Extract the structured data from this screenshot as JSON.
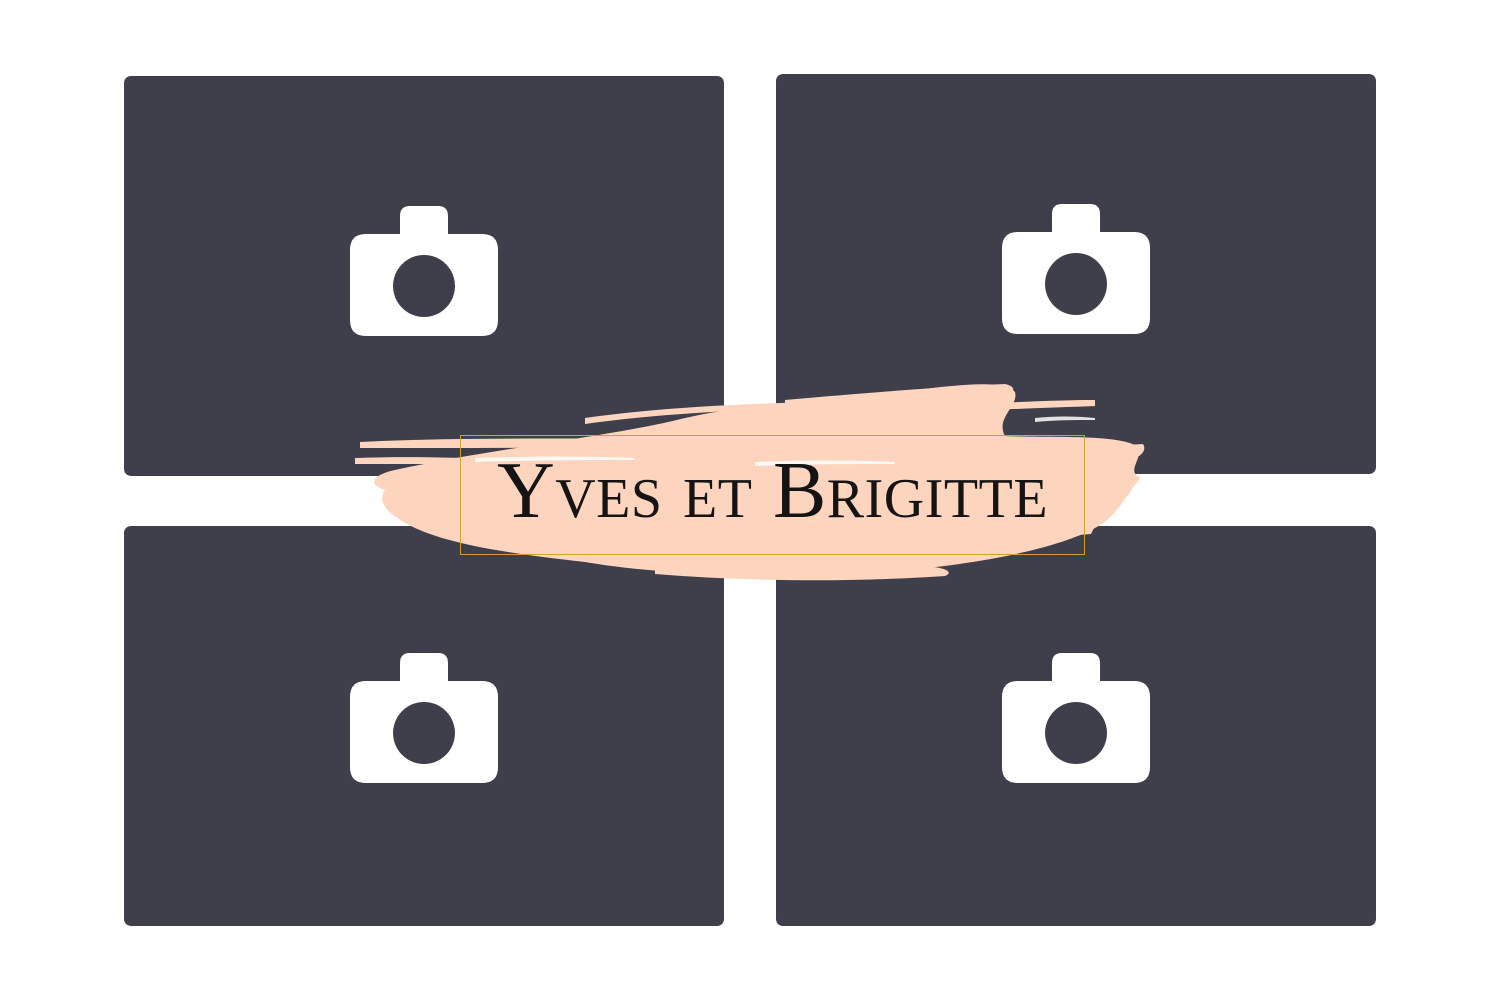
{
  "title": "Yves et Brigitte",
  "colors": {
    "slot_background": "#3f3f4b",
    "icon": "#ffffff",
    "brush": "#fdd4be",
    "frame": "#d4a02c",
    "title_text": "#141414"
  },
  "photo_slots": [
    {
      "icon": "camera-icon"
    },
    {
      "icon": "camera-icon"
    },
    {
      "icon": "camera-icon"
    },
    {
      "icon": "camera-icon"
    }
  ]
}
